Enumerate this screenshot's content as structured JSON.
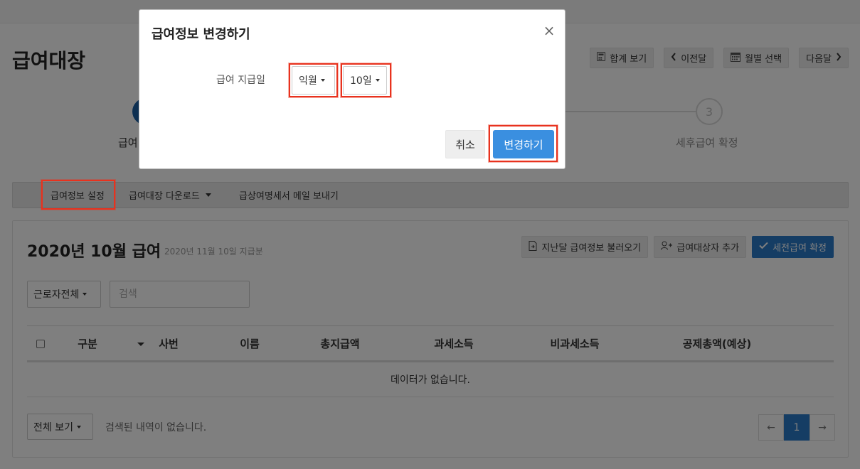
{
  "page": {
    "title": "급여대장",
    "header_buttons": {
      "summary": "합계 보기",
      "prev": "이전달",
      "month_select": "월별 선택",
      "next": "다음달"
    },
    "steps": {
      "step1_label": "급여",
      "step3_number": "3",
      "step3_label": "세후급여 확정"
    },
    "toolbar": {
      "settings": "급여정보 설정",
      "download": "급여대장 다운로드",
      "email": "급상여명세서 메일 보내기"
    },
    "payroll": {
      "title": "2020년 10월 급여",
      "subtitle": "2020년 11월 10일 지급분",
      "actions": {
        "load_prev": "지난달 급여정보 불러오기",
        "add_target": "급여대상자 추가",
        "confirm_pretax": "세전급여 확정"
      }
    },
    "filter": {
      "worker_select": "근로자전체",
      "search_placeholder": "검색"
    },
    "table": {
      "columns": [
        "구분",
        "사번",
        "이름",
        "총지급액",
        "과세소득",
        "비과세소득",
        "공제총액(예상)"
      ],
      "empty_message": "데이터가 없습니다."
    },
    "footer": {
      "view_select": "전체 보기",
      "result_text": "검색된 내역이 없습니다.",
      "pager": {
        "prev": "←",
        "current": "1",
        "next": "→"
      }
    }
  },
  "modal": {
    "title": "급여정보 변경하기",
    "close_symbol": "×",
    "pay_day_label": "급여 지급일",
    "month_select": "익월",
    "day_select": "10일",
    "cancel": "취소",
    "confirm": "변경하기"
  },
  "colors": {
    "primary": "#2b7bc9",
    "modal_primary": "#3a8fe0",
    "highlight": "#e8321e"
  }
}
